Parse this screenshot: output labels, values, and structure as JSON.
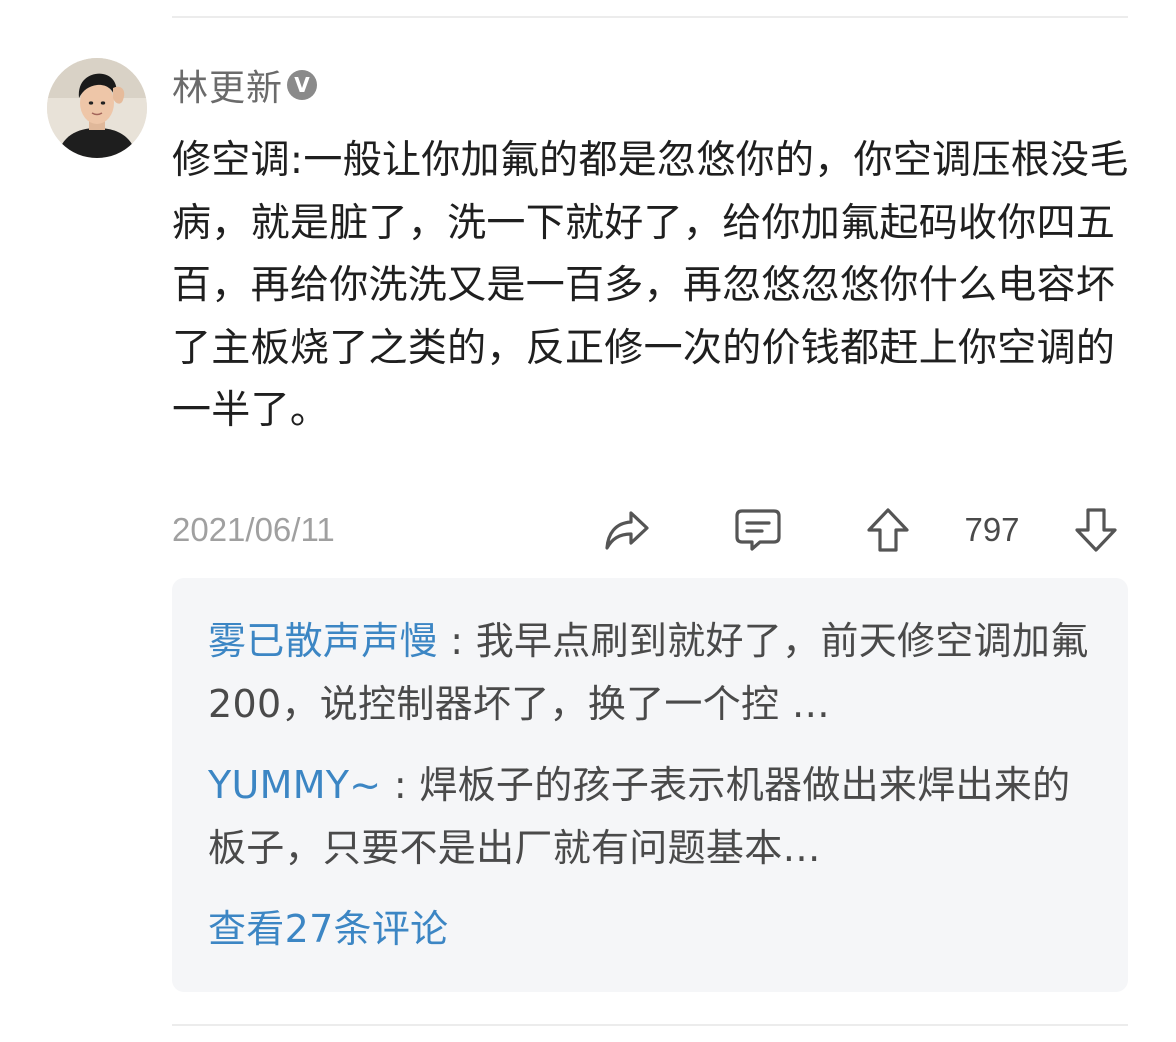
{
  "post": {
    "author": "林更新",
    "verified_badge": "V",
    "text": "修空调:一般让你加氟的都是忽悠你的，你空调压根没毛病，就是脏了，洗一下就好了，给你加氟起码收你四五百，再给你洗洗又是一百多，再忽悠忽悠你什么电容坏了主板烧了之类的，反正修一次的价钱都赶上你空调的一半了。",
    "date": "2021/06/11",
    "vote_count": "797"
  },
  "icons": {
    "share": "share-icon",
    "comment": "comment-icon",
    "upvote": "upvote-icon",
    "downvote": "downvote-icon",
    "verified": "verified-icon",
    "avatar": "avatar-photo"
  },
  "comments": [
    {
      "user": "雾已散声声慢",
      "separator": " : ",
      "text": "我早点刷到就好了，前天修空调加氟200，说控制器坏了，换了一个控 …"
    },
    {
      "user": "YUMMY~",
      "separator": " : ",
      "text": "焊板子的孩子表示机器做出来焊出来的板子，只要不是出厂就有问题基本…"
    }
  ],
  "view_all_comments": "查看27条评论",
  "colors": {
    "link_blue": "#3c86c4",
    "meta_gray": "#a0a0a0",
    "box_bg": "#f5f6f8"
  }
}
